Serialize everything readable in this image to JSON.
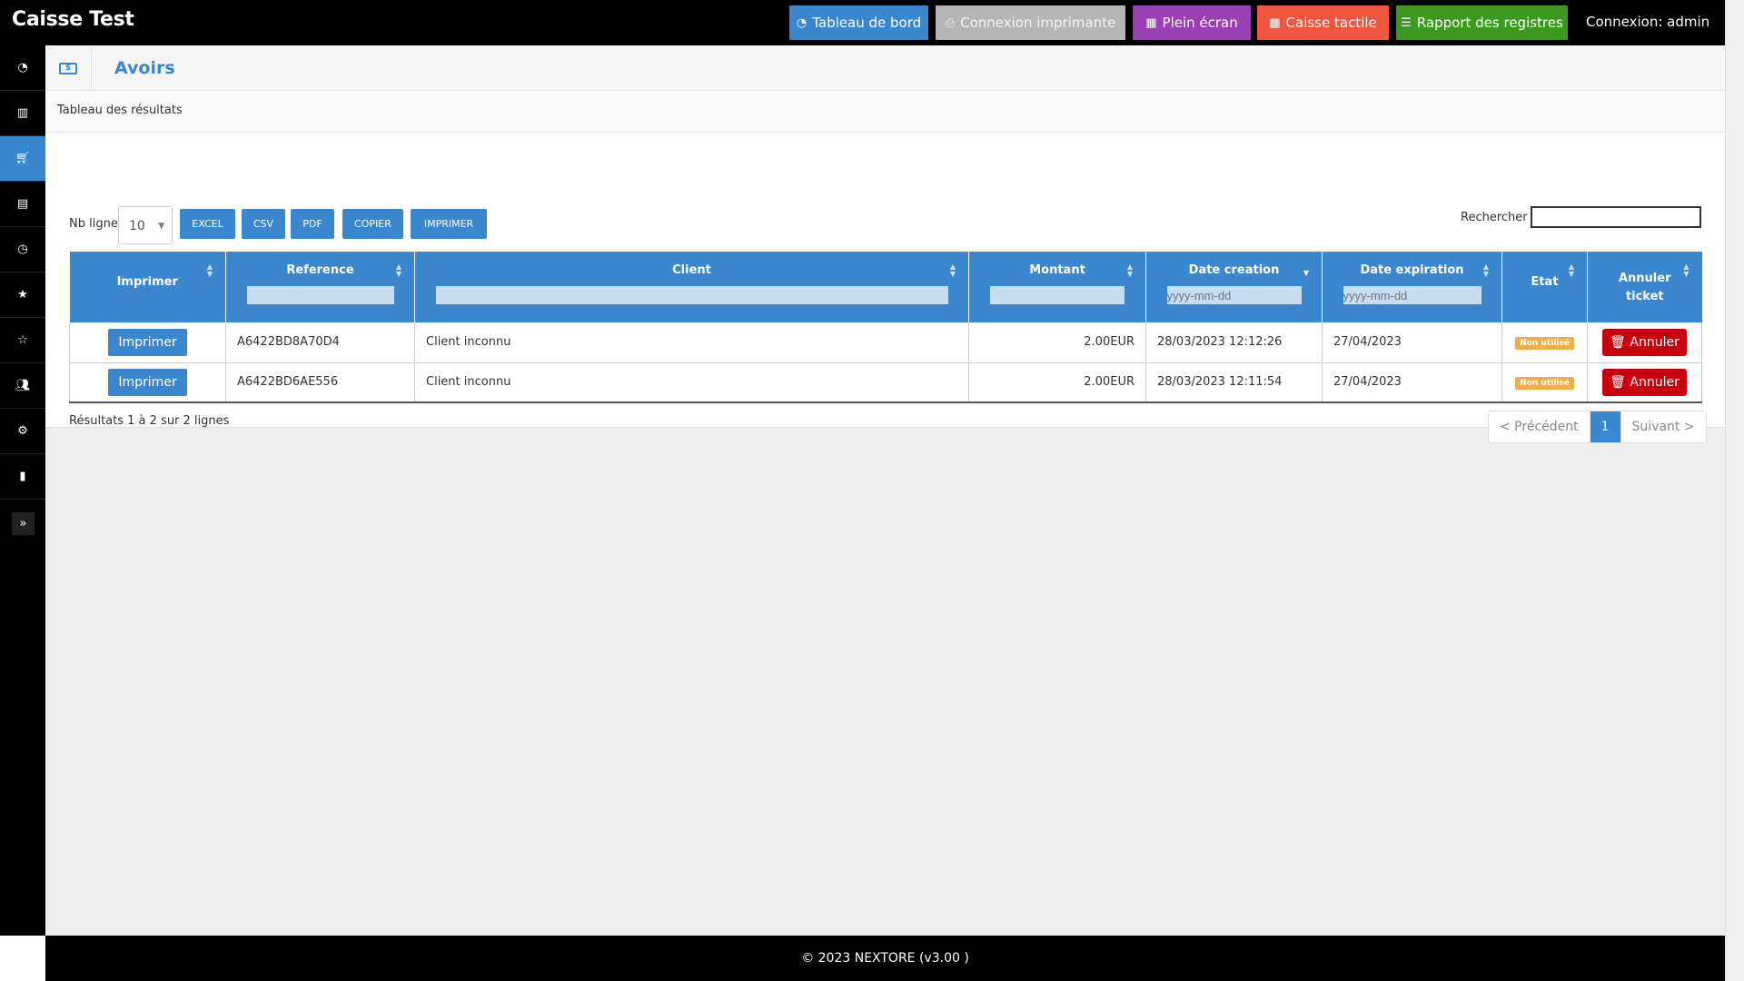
{
  "brand": "Caisse Test",
  "topnav": {
    "buttons": [
      {
        "label": "Tableau de bord",
        "icon": "dashboard-icon",
        "color": "#3a87cf"
      },
      {
        "label": "Connexion imprimante",
        "icon": "printer-icon",
        "color": "#b5b5b5"
      },
      {
        "label": "Plein écran",
        "icon": "grid-icon",
        "color": "#9b3fb4"
      },
      {
        "label": "Caisse tactile",
        "icon": "grid-icon",
        "color": "#f0553e"
      },
      {
        "label": "Rapport des registres",
        "icon": "list-icon",
        "color": "#3b9a1e"
      }
    ],
    "login": "Connexion: admin"
  },
  "sidebar": {
    "items": [
      {
        "icon": "dashboard-icon"
      },
      {
        "icon": "barcode-icon"
      },
      {
        "icon": "cart-icon",
        "active": true
      },
      {
        "icon": "document-icon"
      },
      {
        "icon": "clock-icon"
      },
      {
        "icon": "star-icon"
      },
      {
        "icon": "star-outline-icon"
      },
      {
        "icon": "users-icon"
      },
      {
        "icon": "gear-icon"
      },
      {
        "icon": "bar-chart-icon"
      }
    ],
    "expand_icon": "double-chevron-right-icon"
  },
  "page": {
    "title": "Avoirs",
    "panel_heading": "Tableau des résultats"
  },
  "toolbar": {
    "nb_ligne_label": "Nb ligne",
    "nb_ligne_value": "10",
    "export_buttons": [
      "EXCEL",
      "CSV",
      "PDF",
      "COPIER",
      "IMPRIMER"
    ],
    "search_label": "Rechercher",
    "search_value": ""
  },
  "table": {
    "columns": [
      {
        "label": "Imprimer",
        "filter": null
      },
      {
        "label": "Reference",
        "filter": ""
      },
      {
        "label": "Client",
        "filter": ""
      },
      {
        "label": "Montant",
        "filter": ""
      },
      {
        "label": "Date creation",
        "filter": "",
        "filter_placeholder": "yyyy-mm-dd",
        "sorted": "desc"
      },
      {
        "label": "Date expiration",
        "filter": "",
        "filter_placeholder": "yyyy-mm-dd"
      },
      {
        "label": "Etat",
        "filter": null
      },
      {
        "label": "Annuler ticket",
        "filter": null
      }
    ],
    "rows": [
      {
        "print_label": "Imprimer",
        "reference": "A6422BD8A70D4",
        "client": "Client inconnu",
        "montant": "2.00EUR",
        "date_creation": "28/03/2023 12:12:26",
        "date_expiration": "27/04/2023",
        "etat": "Non utilisé",
        "cancel_label": "Annuler"
      },
      {
        "print_label": "Imprimer",
        "reference": "A6422BD6AE556",
        "client": "Client inconnu",
        "montant": "2.00EUR",
        "date_creation": "28/03/2023 12:11:54",
        "date_expiration": "27/04/2023",
        "etat": "Non utilisé",
        "cancel_label": "Annuler"
      }
    ]
  },
  "results_info": "Résultats 1 à 2 sur 2 lignes",
  "pagination": {
    "prev": "< Précédent",
    "current": "1",
    "next": "Suivant >"
  },
  "footer": "© 2023 NEXTORE (v3.00 )"
}
